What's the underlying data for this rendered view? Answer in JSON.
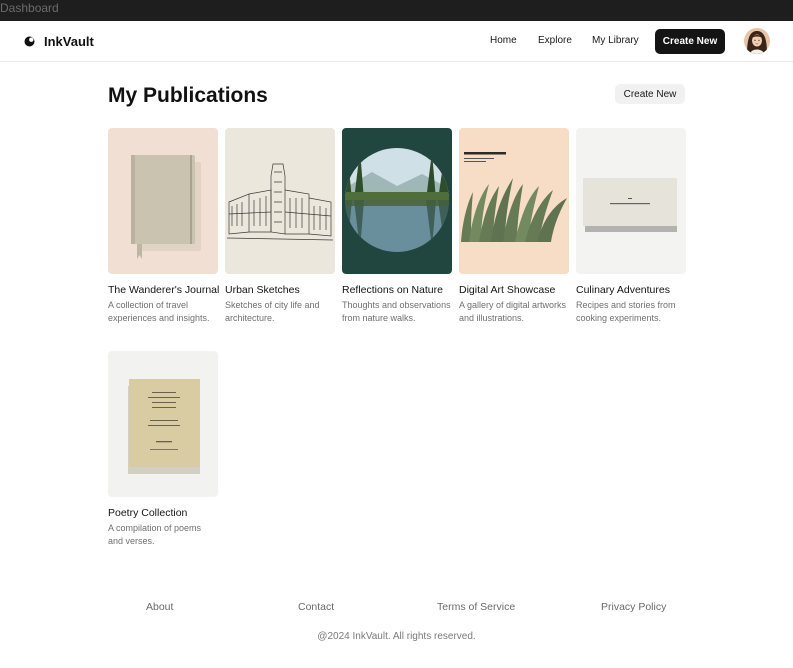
{
  "window": {
    "title": "Dashboard"
  },
  "header": {
    "brand": "InkVault",
    "nav": [
      "Home",
      "Explore",
      "My Library"
    ],
    "create_label": "Create New"
  },
  "main": {
    "title": "My Publications",
    "create_label": "Create New",
    "cards": [
      {
        "title": "The Wanderer's Journal",
        "description": "A collection of travel experiences and insights."
      },
      {
        "title": "Urban Sketches",
        "description": "Sketches of city life and architecture."
      },
      {
        "title": "Reflections on Nature",
        "description": "Thoughts and observations from nature walks."
      },
      {
        "title": "Digital Art Showcase",
        "description": "A gallery of digital artworks and illustrations."
      },
      {
        "title": "Culinary Adventures",
        "description": "Recipes and stories from cooking experiments."
      },
      {
        "title": "Poetry Collection",
        "description": "A compilation of poems and verses."
      }
    ]
  },
  "footer": {
    "links": [
      "About",
      "Contact",
      "Terms of Service",
      "Privacy Policy"
    ],
    "copyright": "@2024 InkVault. All rights reserved."
  },
  "colors": {
    "primary": "#141414",
    "muted_text": "#707070",
    "secondary_button": "#f1f1f1",
    "titlebar": "#1e1e1e"
  }
}
